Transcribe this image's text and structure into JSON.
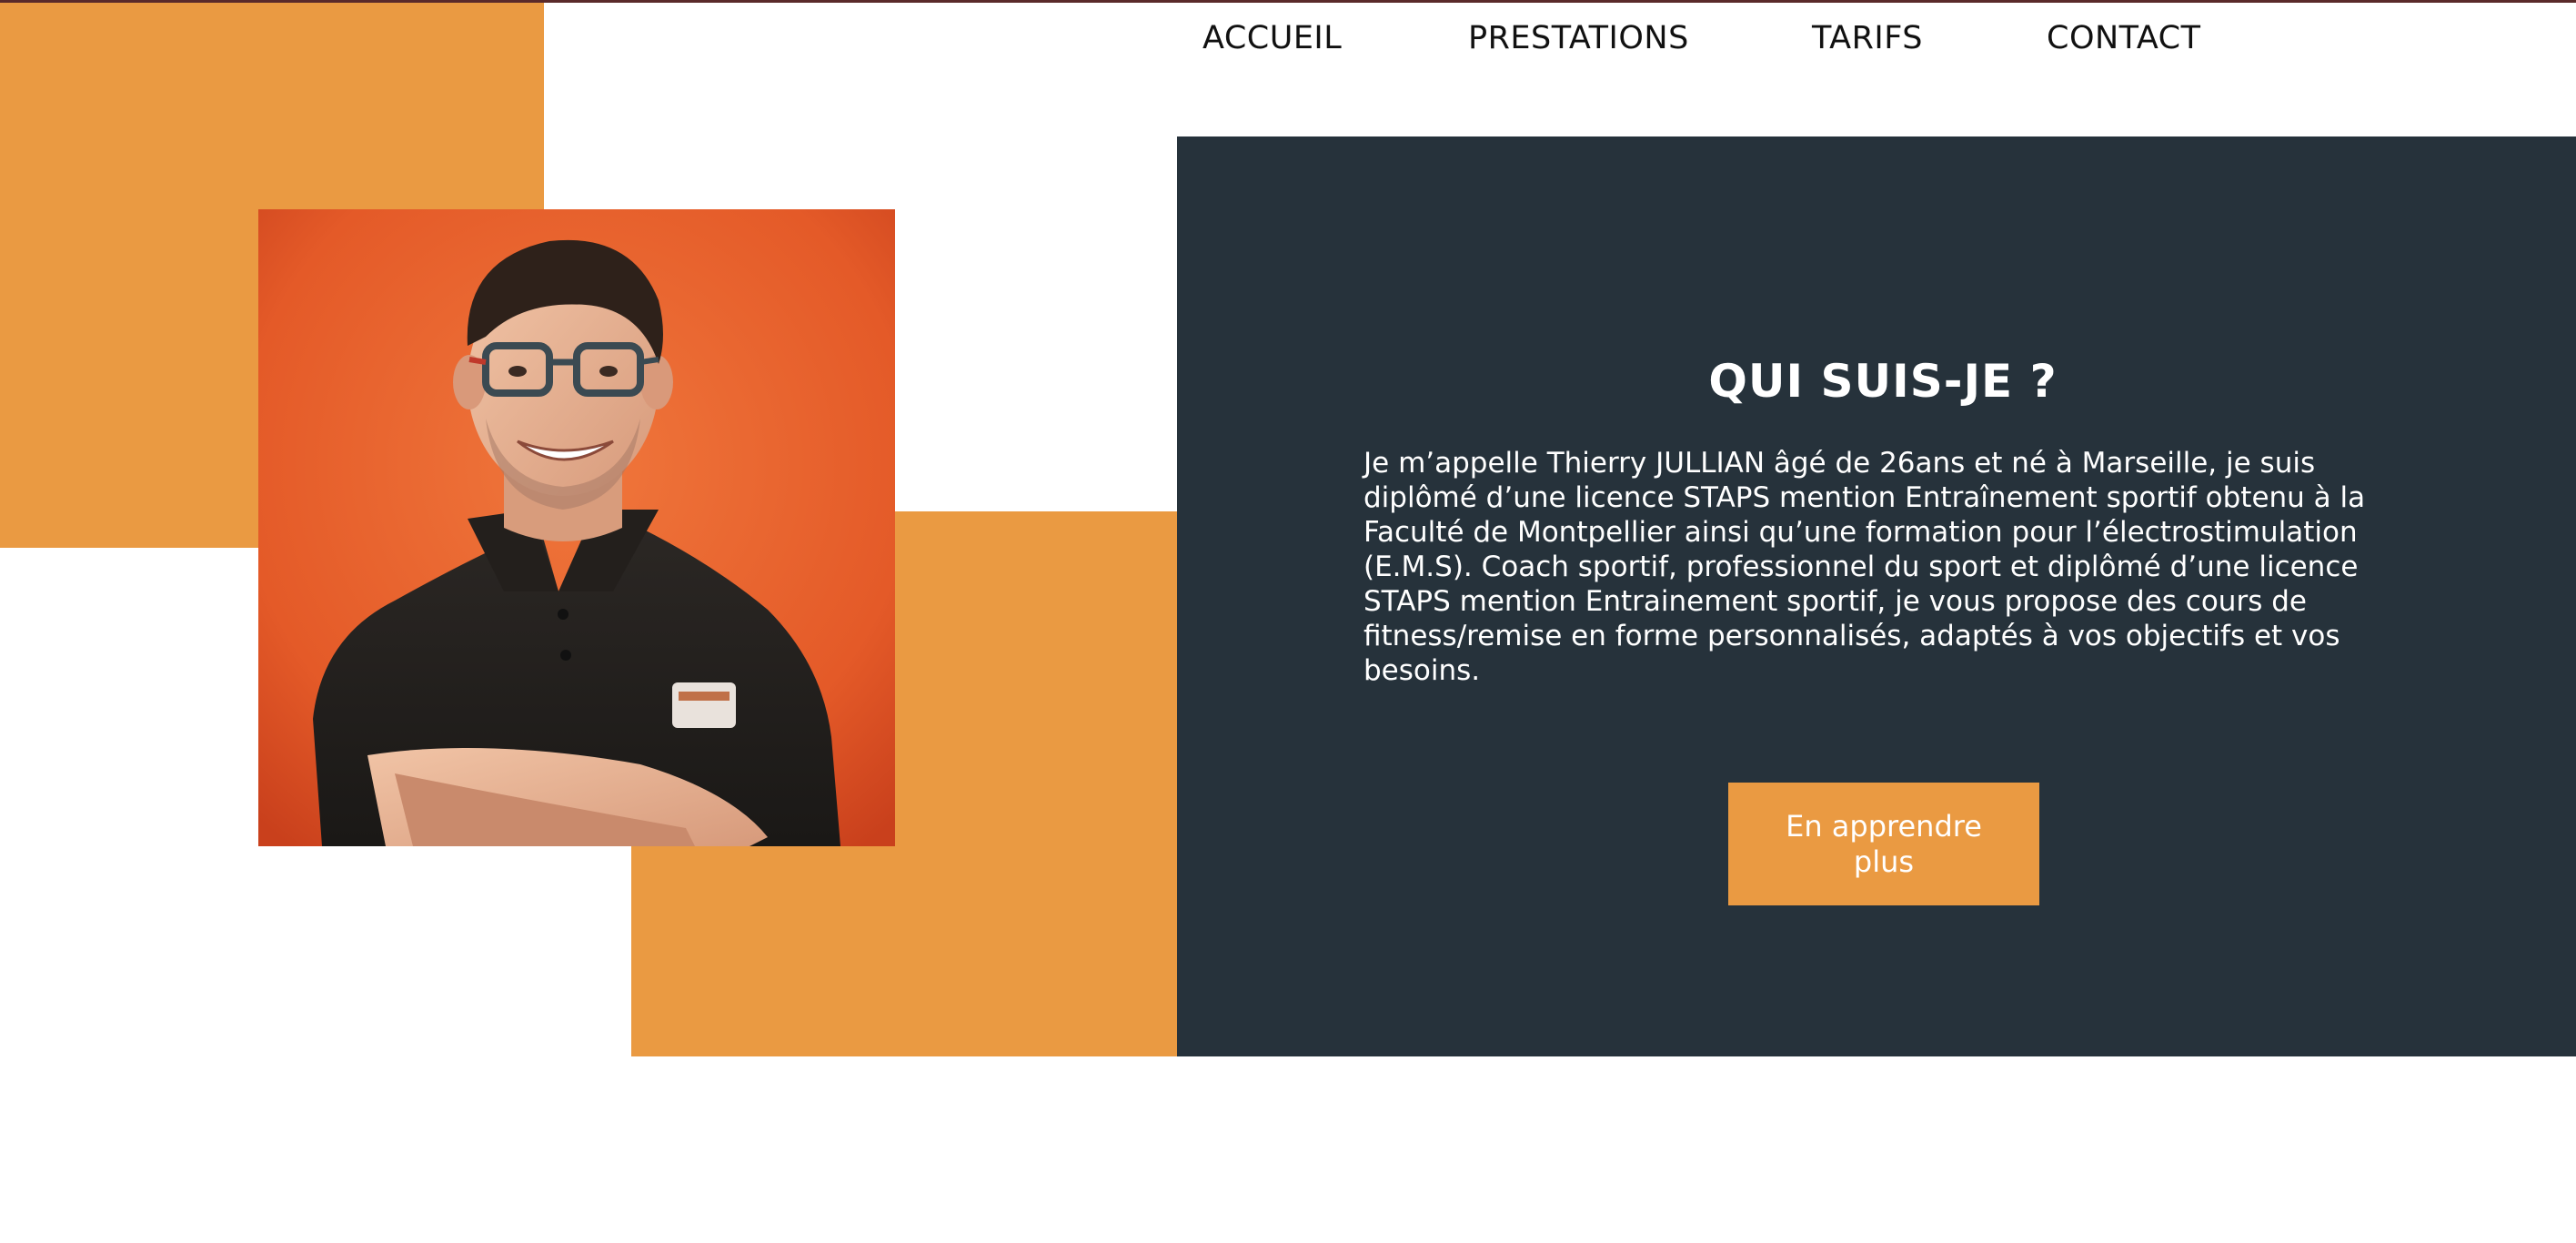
{
  "colors": {
    "orange": "#ea9a42",
    "dark_panel": "#26323b",
    "top_line": "#5a2a2a",
    "photo_background": "#e8622e",
    "text_light": "#ffffff",
    "nav_text": "#111111"
  },
  "nav": {
    "items": [
      {
        "label": "ACCUEIL"
      },
      {
        "label": "PRESTATIONS"
      },
      {
        "label": "TARIFS"
      },
      {
        "label": "CONTACT"
      }
    ]
  },
  "portrait": {
    "icon": "coach-portrait-photo"
  },
  "about": {
    "title": "QUI SUIS-JE ?",
    "text": "Je m’appelle Thierry JULLIAN âgé de 26ans et né à Marseille, je suis diplômé d’une licence STAPS mention Entraînement sportif obtenu à la Faculté de Montpellier ainsi qu’une formation pour l’électrostimulation (E.M.S). Coach sportif, professionnel du sport et diplômé d’une licence STAPS mention Entrainement sportif, je vous propose des cours de fitness/remise en forme personnalisés, adaptés à vos objectifs et vos besoins.",
    "button_label": "En apprendre plus"
  }
}
